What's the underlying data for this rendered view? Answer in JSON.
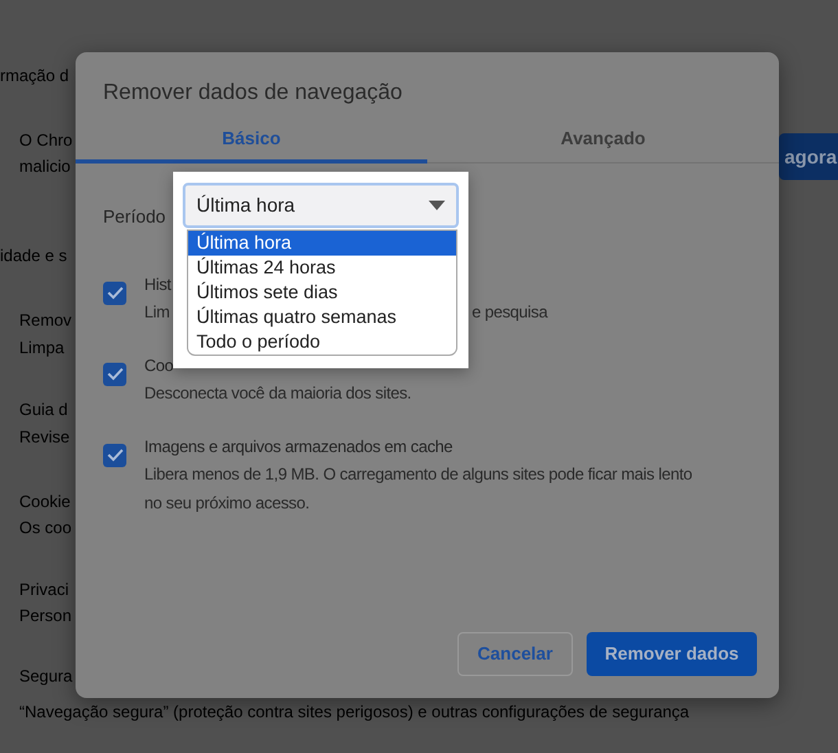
{
  "background_page": {
    "heading": "rmação d",
    "notice": {
      "title": "O Chro",
      "text": "malicio",
      "button": "agora"
    },
    "heading_2": "idade e s",
    "items": [
      {
        "title": "Remov",
        "text": "Limpa"
      },
      {
        "title": "Guia d",
        "text": "Revise"
      },
      {
        "title": "Cookie",
        "text": "Os coo"
      },
      {
        "title": "Privaci",
        "text": "Person"
      },
      {
        "title": "Segura",
        "text": "“Navegação segura” (proteção contra sites perigosos) e outras configurações de segurança"
      }
    ]
  },
  "dialog": {
    "title": "Remover dados de navegação",
    "tabs": [
      {
        "label": "Básico",
        "selected": true
      },
      {
        "label": "Avançado",
        "selected": false
      }
    ],
    "period": {
      "label": "Período",
      "value": "Última hora",
      "expanded": true,
      "options": [
        {
          "label": "Última hora",
          "selected": true
        },
        {
          "label": "Últimas 24 horas",
          "selected": false
        },
        {
          "label": "Últimos sete dias",
          "selected": false
        },
        {
          "label": "Últimas quatro semanas",
          "selected": false
        },
        {
          "label": "Todo o período",
          "selected": false
        }
      ]
    },
    "items": [
      {
        "title": "Hist",
        "text": "Lim",
        "text_after": "e pesquisa",
        "checked": true
      },
      {
        "title": "Coo",
        "text": "Desconecta você da maioria dos sites.",
        "checked": true
      },
      {
        "title": "Imagens e arquivos armazenados em cache",
        "text": "Libera menos de 1,9 MB. O carregamento de alguns sites pode ficar mais lento no seu próximo acesso.",
        "checked": true
      }
    ],
    "buttons": [
      {
        "label": "Cancelar",
        "kind": "secondary"
      },
      {
        "label": "Remover dados",
        "kind": "primary"
      }
    ]
  }
}
